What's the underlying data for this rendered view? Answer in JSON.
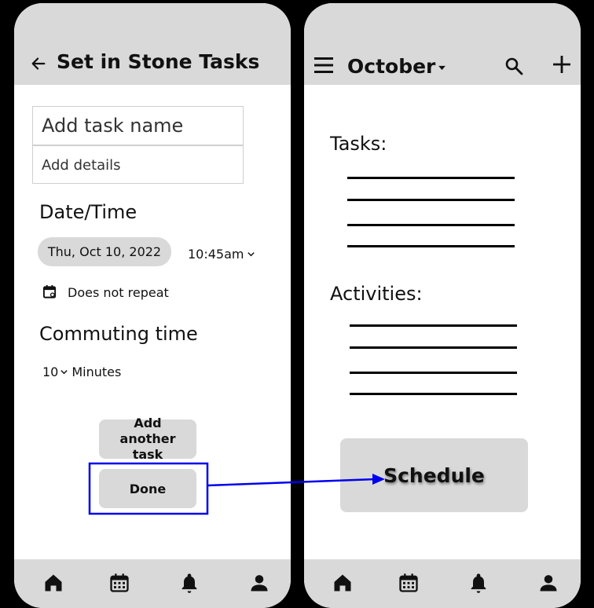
{
  "left": {
    "title": "Set in Stone Tasks",
    "task_name_placeholder": "Add task name",
    "details_placeholder": "Add details",
    "datetime_heading": "Date/Time",
    "date_chip": "Thu, Oct 10, 2022",
    "time_value": "10:45am",
    "repeat_label": "Does not repeat",
    "commute_heading": "Commuting time",
    "commute_value": "10",
    "commute_unit": "Minutes",
    "add_another_label": "Add another task",
    "done_label": "Done"
  },
  "right": {
    "month": "October",
    "tasks_heading": "Tasks:",
    "activities_heading": "Activities:",
    "schedule_label": "Schedule"
  },
  "nav": {
    "items": [
      "home-icon",
      "calendar-icon",
      "bell-icon",
      "person-icon"
    ]
  },
  "colors": {
    "bar": "#d9d9d9",
    "annotation": "#0000ee"
  }
}
